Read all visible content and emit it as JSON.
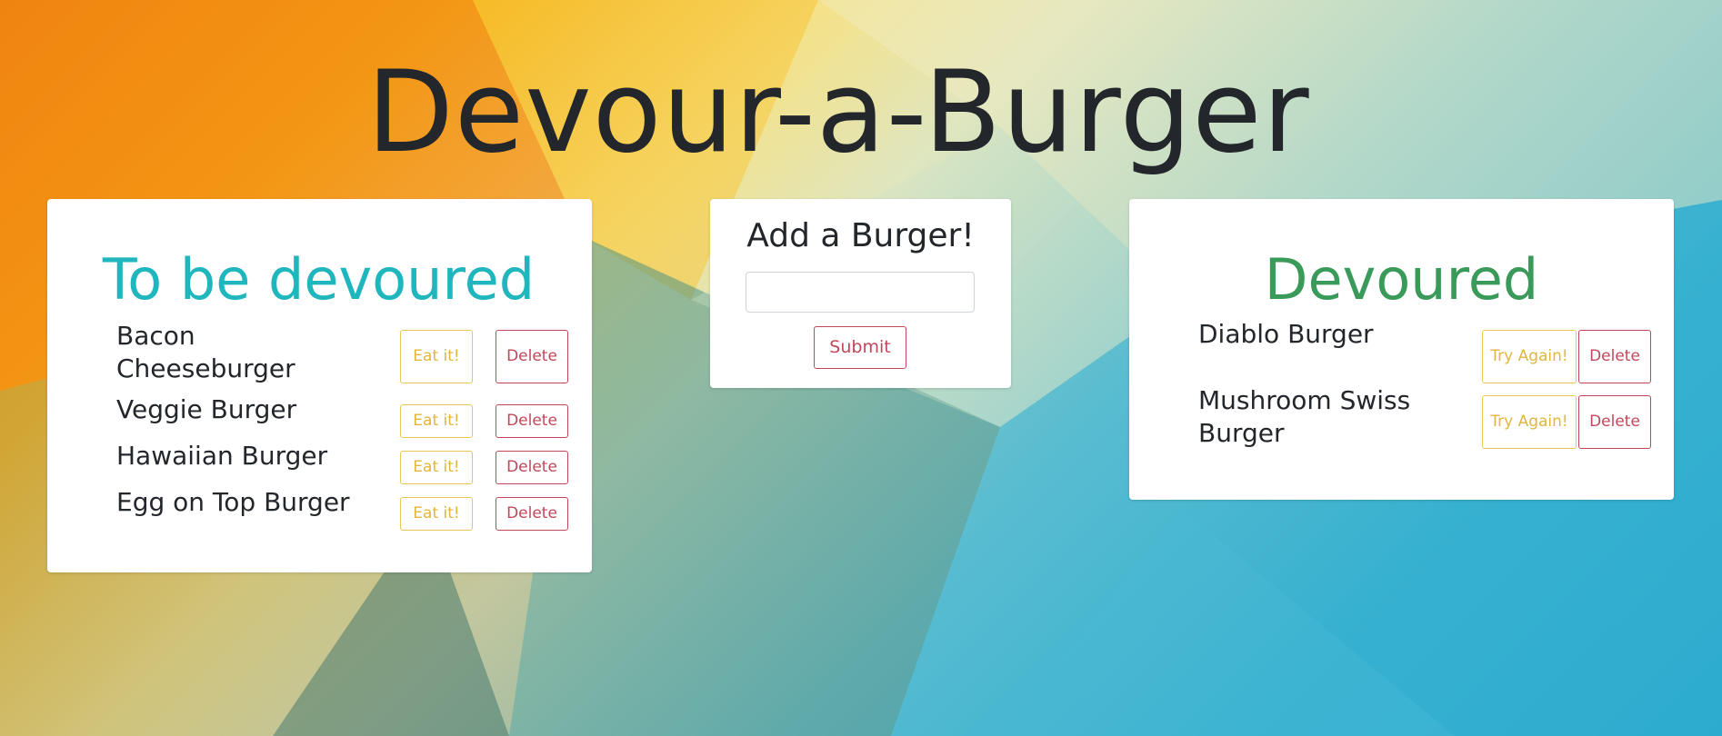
{
  "page": {
    "title": "Devour-a-Burger"
  },
  "undevoured": {
    "heading": "To be devoured",
    "eat_label": "Eat it!",
    "delete_label": "Delete",
    "burgers": [
      {
        "name": "Bacon Cheeseburger"
      },
      {
        "name": "Veggie Burger"
      },
      {
        "name": "Hawaiian Burger"
      },
      {
        "name": "Egg on Top Burger"
      }
    ]
  },
  "add_form": {
    "heading": "Add a Burger!",
    "input_value": "",
    "input_placeholder": "",
    "submit_label": "Submit"
  },
  "devoured": {
    "heading": "Devoured",
    "try_again_label": "Try Again!",
    "delete_label": "Delete",
    "burgers": [
      {
        "name": "Diablo Burger"
      },
      {
        "name": "Mushroom Swiss Burger"
      }
    ]
  },
  "colors": {
    "undevoured_heading": "#1fb6bd",
    "devoured_heading": "#3a9a5a",
    "delete_outline": "#c0485a",
    "eat_outline": "#e0b63c",
    "title_text": "#23262b"
  }
}
